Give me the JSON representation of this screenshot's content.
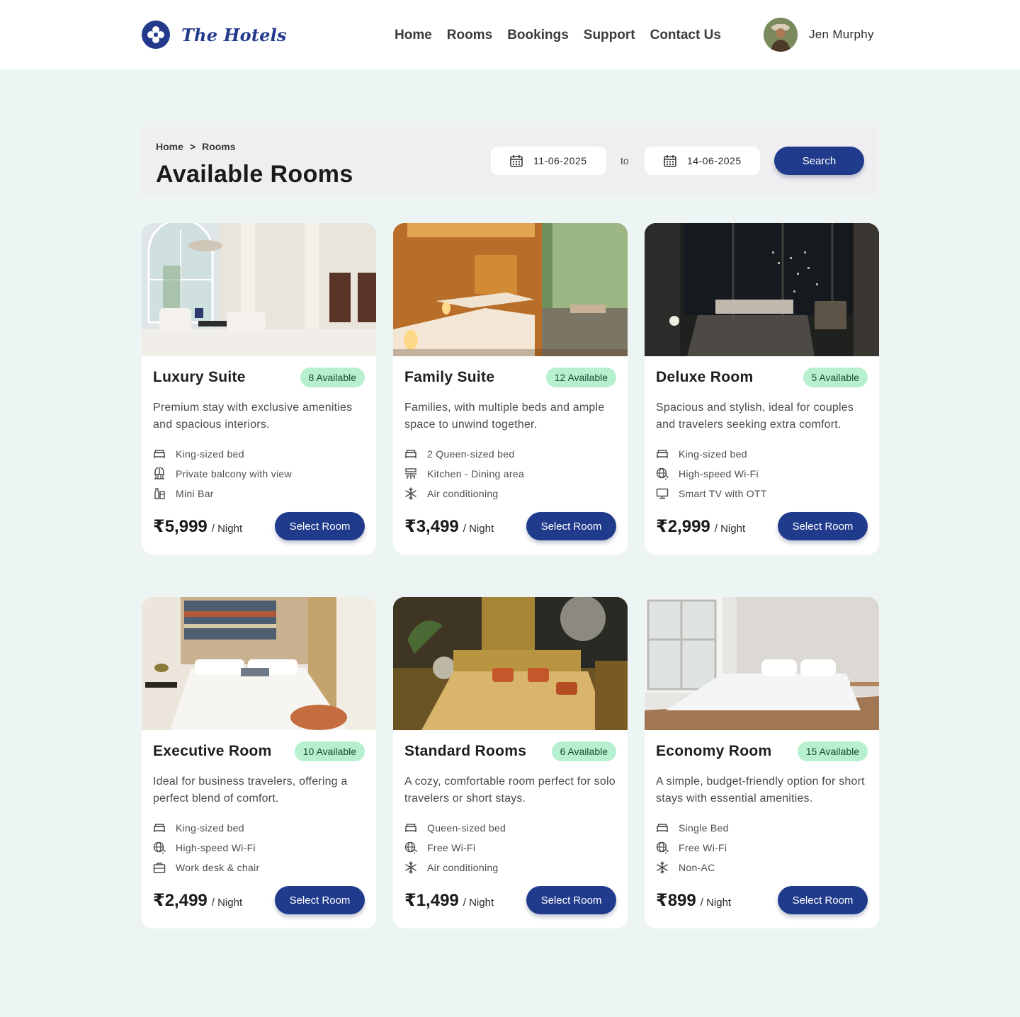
{
  "header": {
    "brand_name": "The Hotels",
    "nav": [
      "Home",
      "Rooms",
      "Bookings",
      "Support",
      "Contact Us"
    ],
    "user_name": "Jen Murphy"
  },
  "search": {
    "breadcrumb": [
      "Home",
      ">",
      "Rooms"
    ],
    "title": "Available Rooms",
    "date_from": "11-06-2025",
    "to_label": "to",
    "date_to": "14-06-2025",
    "search_label": "Search"
  },
  "rooms": [
    {
      "title": "Luxury Suite",
      "badge": "8 Available",
      "desc": "Premium stay with exclusive amenities and spacious interiors.",
      "features": [
        {
          "icon": "bed-icon",
          "label": "King-sized bed"
        },
        {
          "icon": "balcony-icon",
          "label": "Private balcony with view"
        },
        {
          "icon": "minibar-icon",
          "label": "Mini Bar"
        }
      ],
      "price": "₹5,999",
      "per": "/ Night",
      "button": "Select Room"
    },
    {
      "title": "Family Suite",
      "badge": "12 Available",
      "desc": "Families, with multiple beds and ample space to unwind together.",
      "features": [
        {
          "icon": "bed-icon",
          "label": "2 Queen-sized bed"
        },
        {
          "icon": "dining-icon",
          "label": "Kitchen - Dining area"
        },
        {
          "icon": "snowflake-icon",
          "label": "Air conditioning"
        }
      ],
      "price": "₹3,499",
      "per": "/ Night",
      "button": "Select Room"
    },
    {
      "title": "Deluxe Room",
      "badge": "5 Available",
      "desc": "Spacious and stylish, ideal for couples and travelers seeking extra comfort.",
      "features": [
        {
          "icon": "bed-icon",
          "label": "King-sized bed"
        },
        {
          "icon": "wifi-globe-icon",
          "label": "High-speed Wi-Fi"
        },
        {
          "icon": "tv-icon",
          "label": "Smart TV with OTT"
        }
      ],
      "price": "₹2,999",
      "per": "/ Night",
      "button": "Select Room"
    },
    {
      "title": "Executive Room",
      "badge": "10 Available",
      "desc": "Ideal for business travelers, offering a perfect blend of comfort.",
      "features": [
        {
          "icon": "bed-icon",
          "label": "King-sized bed"
        },
        {
          "icon": "wifi-globe-icon",
          "label": "High-speed Wi-Fi"
        },
        {
          "icon": "briefcase-icon",
          "label": "Work desk & chair"
        }
      ],
      "price": "₹2,499",
      "per": "/ Night",
      "button": "Select Room"
    },
    {
      "title": "Standard Rooms",
      "badge": "6 Available",
      "desc": "A cozy, comfortable room perfect for solo travelers or short stays.",
      "features": [
        {
          "icon": "bed-icon",
          "label": "Queen-sized bed"
        },
        {
          "icon": "wifi-globe-icon",
          "label": "Free Wi-Fi"
        },
        {
          "icon": "snowflake-icon",
          "label": "Air conditioning"
        }
      ],
      "price": "₹1,499",
      "per": "/ Night",
      "button": "Select Room"
    },
    {
      "title": "Economy Room",
      "badge": "15 Available",
      "desc": "A simple, budget-friendly option for short stays with essential amenities.",
      "features": [
        {
          "icon": "bed-icon",
          "label": "Single Bed"
        },
        {
          "icon": "wifi-globe-icon",
          "label": "Free Wi-Fi"
        },
        {
          "icon": "snowflake-icon",
          "label": "Non-AC"
        }
      ],
      "price": "₹899",
      "per": "/ Night",
      "button": "Select Room"
    }
  ]
}
